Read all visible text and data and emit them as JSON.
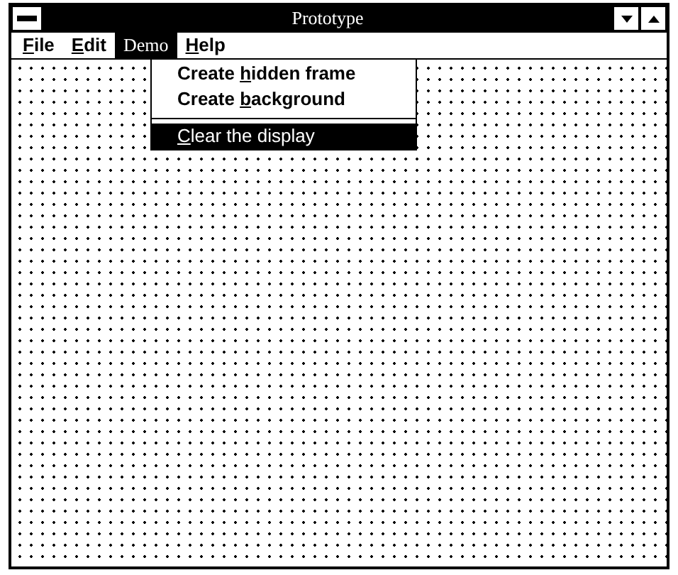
{
  "window": {
    "title": "Prototype"
  },
  "menu_bar": [
    {
      "key": "F",
      "post": "ile",
      "selected": false
    },
    {
      "key": "E",
      "post": "dit",
      "selected": false
    },
    {
      "pre": "Demo",
      "selected": true
    },
    {
      "key": "H",
      "post": "elp",
      "selected": false
    }
  ],
  "dropdown": [
    {
      "kind": "item",
      "pre": "Create ",
      "key": "h",
      "post": "idden frame",
      "selected": false
    },
    {
      "kind": "item",
      "pre": "Create ",
      "key": "b",
      "post": "ackground",
      "selected": false
    },
    {
      "kind": "separator"
    },
    {
      "kind": "item",
      "key": "C",
      "post": "lear the display",
      "selected": true
    }
  ]
}
